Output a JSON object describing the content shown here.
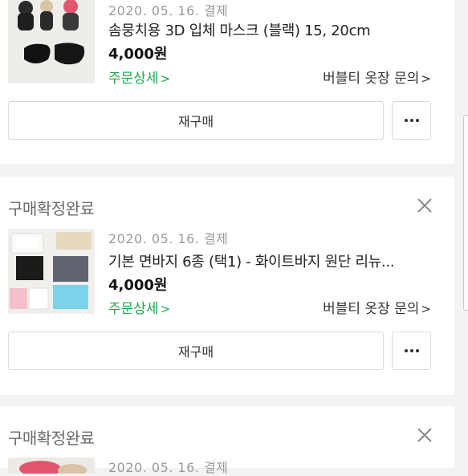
{
  "orders": [
    {
      "date": "2020. 05. 16. 결제",
      "title": "솜뭉치용 3D 입체 마스크 (블랙) 15, 20cm",
      "price": "4,000원",
      "detail_label": "주문상세",
      "seller_label": "버블티 옷장 문의",
      "rebuy_label": "재구매",
      "thumb_icon": "black-mask-product-photo"
    },
    {
      "status": "구매확정완료",
      "date": "2020. 05. 16. 결제",
      "title": "기본 면바지 6종 (택1) - 화이트바지 원단 리뉴...",
      "price": "4,000원",
      "detail_label": "주문상세",
      "seller_label": "버블티 옷장 문의",
      "rebuy_label": "재구매",
      "thumb_icon": "doll-pants-product-photo"
    },
    {
      "status": "구매확정완료",
      "date": "2020. 05. 16. 결제",
      "thumb_icon": "product-photo"
    }
  ],
  "colors": {
    "detail_green": "#1ea64a",
    "background": "#f2f3f5"
  }
}
